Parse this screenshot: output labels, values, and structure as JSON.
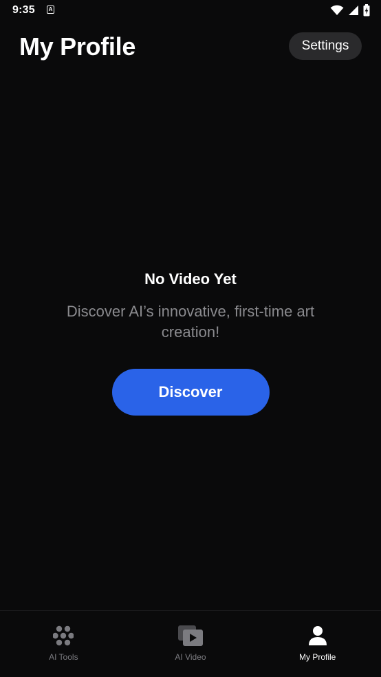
{
  "status_bar": {
    "time": "9:35",
    "notification_letter": "A"
  },
  "header": {
    "title": "My Profile",
    "settings_label": "Settings"
  },
  "empty_state": {
    "title": "No Video Yet",
    "description": "Discover AI’s innovative, first-time art creation!",
    "button_label": "Discover"
  },
  "bottom_nav": {
    "items": [
      {
        "label": "AI Tools",
        "icon": "dots-grid-icon",
        "active": false
      },
      {
        "label": "AI Video",
        "icon": "video-play-icon",
        "active": false
      },
      {
        "label": "My Profile",
        "icon": "person-icon",
        "active": true
      }
    ]
  },
  "colors": {
    "background": "#0a0a0b",
    "accent": "#2a63e8",
    "muted_text": "#8a8a8e",
    "inactive_nav": "#7b7b80"
  }
}
